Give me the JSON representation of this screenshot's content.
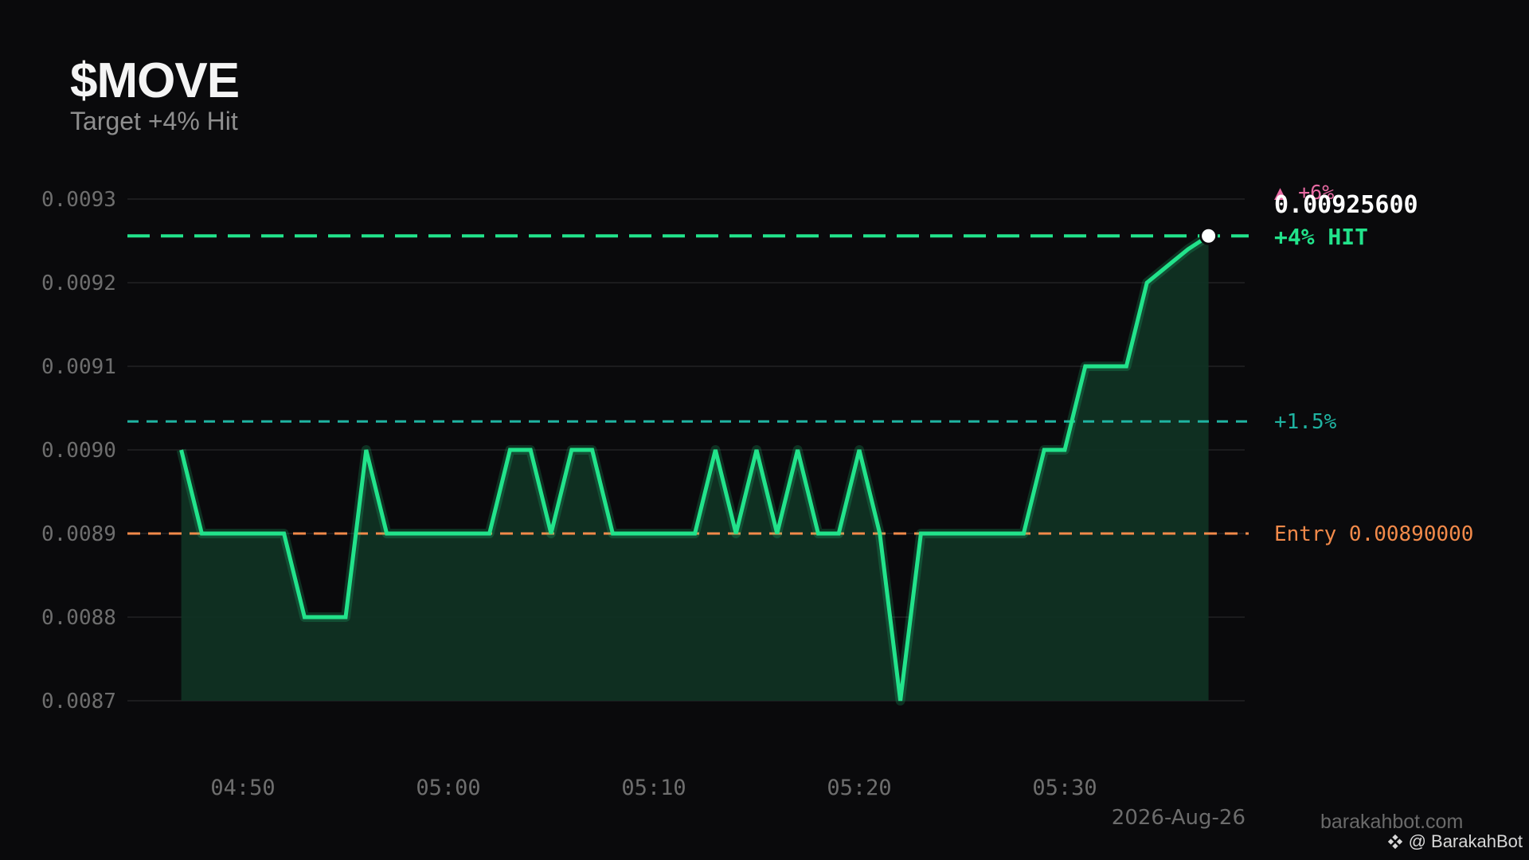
{
  "header": {
    "title": "$MOVE",
    "subtitle": "Target +4% Hit"
  },
  "labels": {
    "price": "0.00925600",
    "target_hit": "+4%  HIT",
    "stop_top": "▲ +6%",
    "mid_level": "+1.5%",
    "entry": "Entry 0.00890000",
    "date": "2026-Aug-26",
    "site": "barakahbot.com",
    "credit": "@ BarakahBot"
  },
  "colors": {
    "line": "#22e38b",
    "fill": "#0f3324",
    "target": "#22e38b",
    "mid": "#1fb3a1",
    "entry": "#f28a4a",
    "top": "#e86aa3",
    "grid": "#1c1c1e",
    "axis_text": "#6e6e6e"
  },
  "chart_data": {
    "type": "line",
    "title": "$MOVE",
    "subtitle": "Target +4% Hit",
    "xlabel": "",
    "ylabel": "",
    "ylim": [
      0.0087,
      0.0093
    ],
    "xlim": [
      "04:47",
      "05:37"
    ],
    "grid": true,
    "y_ticks": [
      "0.0093",
      "0.0092",
      "0.0091",
      "0.0090",
      "0.0089",
      "0.0088",
      "0.0087"
    ],
    "x_ticks": [
      "04:50",
      "05:00",
      "05:10",
      "05:20",
      "05:30"
    ],
    "series": [
      {
        "x": [
          "04:47",
          "04:48",
          "04:49",
          "04:50",
          "04:51",
          "04:52",
          "04:53",
          "04:54",
          "04:55",
          "04:56",
          "04:57",
          "04:58",
          "04:59",
          "05:00",
          "05:01",
          "05:02",
          "05:03",
          "05:04",
          "05:05",
          "05:06",
          "05:07",
          "05:08",
          "05:09",
          "05:10",
          "05:11",
          "05:12",
          "05:13",
          "05:14",
          "05:15",
          "05:16",
          "05:17",
          "05:18",
          "05:19",
          "05:20",
          "05:21",
          "05:22",
          "05:23",
          "05:24",
          "05:25",
          "05:26",
          "05:27",
          "05:28",
          "05:29",
          "05:30",
          "05:31",
          "05:32",
          "05:33",
          "05:34",
          "05:35",
          "05:36",
          "05:37"
        ],
        "values": [
          0.009,
          0.0089,
          0.0089,
          0.0089,
          0.0089,
          0.0089,
          0.0088,
          0.0088,
          0.0088,
          0.009,
          0.0089,
          0.0089,
          0.0089,
          0.0089,
          0.0089,
          0.0089,
          0.009,
          0.009,
          0.0089,
          0.009,
          0.009,
          0.0089,
          0.0089,
          0.0089,
          0.0089,
          0.0089,
          0.009,
          0.0089,
          0.009,
          0.0089,
          0.009,
          0.0089,
          0.0089,
          0.009,
          0.0089,
          0.0087,
          0.0089,
          0.0089,
          0.0089,
          0.0089,
          0.0089,
          0.0089,
          0.009,
          0.009,
          0.0091,
          0.0091,
          0.0091,
          0.0092,
          0.00922,
          0.00924,
          0.009256
        ]
      }
    ],
    "reference_lines": [
      {
        "label": "+4%  HIT",
        "value": 0.009256,
        "style": "long-dash"
      },
      {
        "label": "+1.5%",
        "value": 0.009034,
        "style": "dash"
      },
      {
        "label": "Entry 0.00890000",
        "value": 0.0089,
        "style": "dash"
      }
    ],
    "annotations": [
      "▲ +6%",
      "0.00925600"
    ],
    "current_point": {
      "x": "05:37",
      "value": 0.009256
    }
  }
}
